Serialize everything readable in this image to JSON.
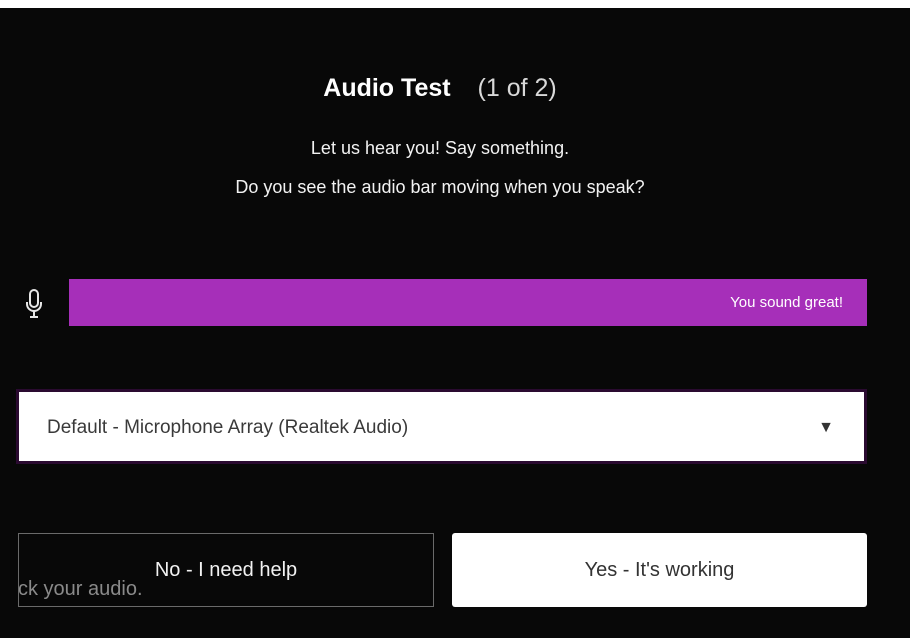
{
  "dialog": {
    "title": "Audio Test",
    "step": "(1 of 2)",
    "instruction": "Let us hear you! Say something.",
    "question": "Do you see the audio bar moving when you speak?"
  },
  "audio_meter": {
    "status_text": "You sound great!",
    "bar_color": "#a62fb9",
    "icon": "microphone-icon"
  },
  "microphone_select": {
    "selected": "Default - Microphone Array (Realtek Audio)",
    "arrow_icon": "dropdown-triangle-icon"
  },
  "background_text": "ck your audio.",
  "buttons": {
    "no_label": "No - I need help",
    "yes_label": "Yes - It's working"
  }
}
